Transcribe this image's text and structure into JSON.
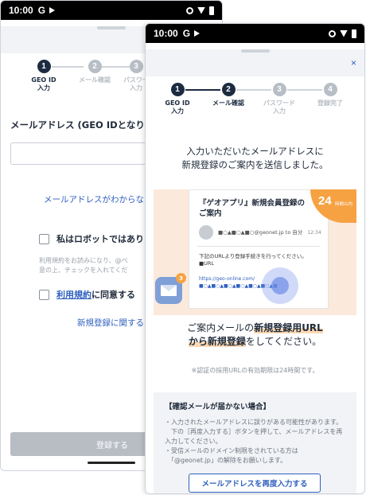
{
  "status_bar": {
    "time": "10:00",
    "g": "G"
  },
  "back_screen": {
    "steps": [
      {
        "num": "1",
        "label": "GEO ID\n入力"
      },
      {
        "num": "2",
        "label": "メール確認"
      },
      {
        "num": "3",
        "label": "パスワー\n入力"
      }
    ],
    "email_label": "メールアドレス (GEO IDとなりま",
    "forgot_link": "メールアドレスがわからな",
    "robot_label": "私はロボットではあり",
    "note": "利用規約をお読みになり、@ベ\n意の上、チェックを入れてくだ",
    "terms_link": "利用規約",
    "terms_rest": "に同意する",
    "register_link": "新規登録に関する",
    "submit_label": "登録する"
  },
  "front_screen": {
    "close": "×",
    "steps": [
      {
        "num": "1",
        "label": "GEO ID\n入力"
      },
      {
        "num": "2",
        "label": "メール確認"
      },
      {
        "num": "3",
        "label": "パスワード\n入力"
      },
      {
        "num": "4",
        "label": "登録完了"
      }
    ],
    "message": "入力いただいたメールアドレスに\n新規登録のご案内を送信しました。",
    "illustration": {
      "subject": "『ゲオアプリ』新規会員登録の\nご案内",
      "from_addr": "■○▲■○▲■○@geonet.jp\nto 自分",
      "from_time": "12:34",
      "body": "下記のURLより登録手続きを行ってください。\n■URL",
      "url": "https://geo-online.com/\n■○▲■○▲■○▲■○▲■○▲■○▲■",
      "badge_num": "24",
      "badge_text": "時間以内",
      "mail_count": "3",
      "cta_pre": "ご案内メールの",
      "cta_bold1": "新規登録用URL",
      "cta_bold2": "から新規登録",
      "cta_post": "をしてください。"
    },
    "validity_note": "※認証の採用URLの有効期限は24時間です。",
    "warning_title": "【確認メールが届かない場合】",
    "warning_text": "・入力されたメールアドレスに誤りがある可能性があります。\n　下の［再度入力する］ボタンを押して、メールアドレスを再入力してください。\n・受信メールのドメイン制限をされている方は\n　「@geonet.jp」の解除をお願いします。",
    "reenter_button": "メールアドレスを再度入力する"
  }
}
